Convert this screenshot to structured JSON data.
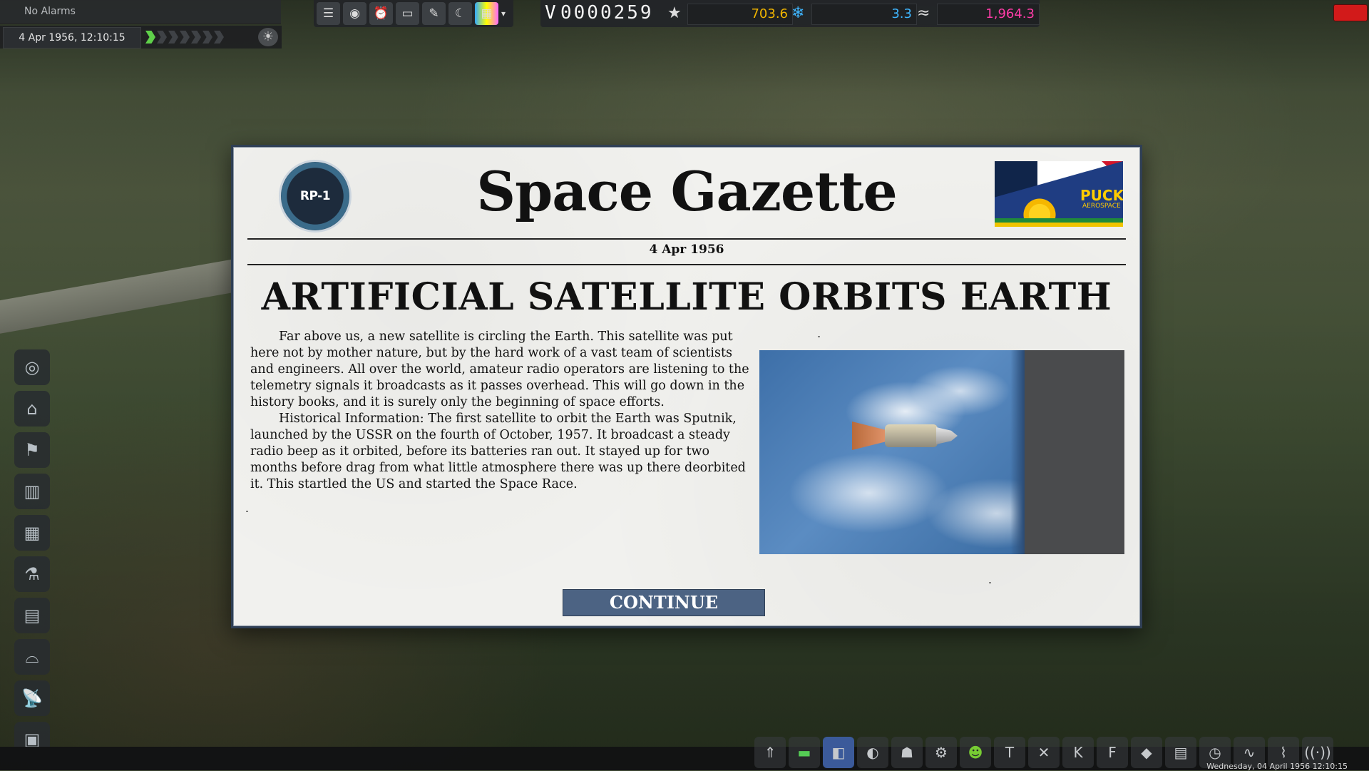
{
  "alarm": {
    "text": "No Alarms"
  },
  "clock": {
    "datetime": "4 Apr 1956, 12:10:15"
  },
  "toolbar": {
    "icons": [
      "clipboard-icon",
      "globe-icon",
      "alarm-clock-icon",
      "camera-icon",
      "pen-icon",
      "moon-icon",
      "palette-icon"
    ],
    "dropdown_glyph": "▾"
  },
  "funds": {
    "symbol": "V",
    "value": "0000259"
  },
  "resources": {
    "reputation": {
      "value": "703.6",
      "color": "#f0b400",
      "icon": "star-icon"
    },
    "science": {
      "value": "3.3",
      "color": "#3fb6ff",
      "icon": "snowflake-icon"
    },
    "confidence": {
      "value": "1,964.3",
      "color": "#ff3ca8",
      "icon": "wave-icon"
    }
  },
  "sidebar": {
    "items": [
      "astronaut-complex-icon",
      "mission-control-icon",
      "tracking-station-icon",
      "vehicle-assembly-icon",
      "spaceplane-hangar-icon",
      "research-icon",
      "launchpad-icon",
      "runway-icon",
      "antenna-icon",
      "admin-icon"
    ]
  },
  "newspaper": {
    "title": "Space Gazette",
    "date": "4 Apr 1956",
    "headline": "ARTIFICIAL SATELLITE ORBITS EARTH",
    "paragraph1": "Far above us, a new satellite is circling the Earth. This satellite was put here not by mother nature, but by the hard work of a vast team of scientists and engineers. All over the world, amateur radio operators are listening to the telemetry signals it broadcasts as it passes overhead. This will go down in the history books, and it is surely only the beginning of space efforts.",
    "paragraph2": "Historical Information: The first satellite to orbit the Earth was Sputnik, launched by the USSR on the fourth of October, 1957. It broadcast a steady radio beep as it orbited, before its batteries ran out. It stayed up for two months before drag from what little atmosphere there was up there deorbited it. This startled the US and started the Space Race.",
    "continue_label": "CONTINUE",
    "left_logo_text": "RP-1",
    "right_logo_text": "PUCK",
    "right_logo_sub": "AEROSPACE"
  },
  "bottom": {
    "icons": [
      "rocket-icon",
      "stack-icon",
      "map-icon",
      "navball-icon",
      "robot-icon",
      "gear-icon",
      "kerbal-icon",
      "tweakscale-icon",
      "wrench-icon",
      "kac-icon",
      "far-icon",
      "diamond-icon",
      "book-icon",
      "timer-icon",
      "graph-icon",
      "signal-icon",
      "antenna-icon"
    ],
    "datetime": "Wednesday, 04 April 1956 12:10:15"
  }
}
